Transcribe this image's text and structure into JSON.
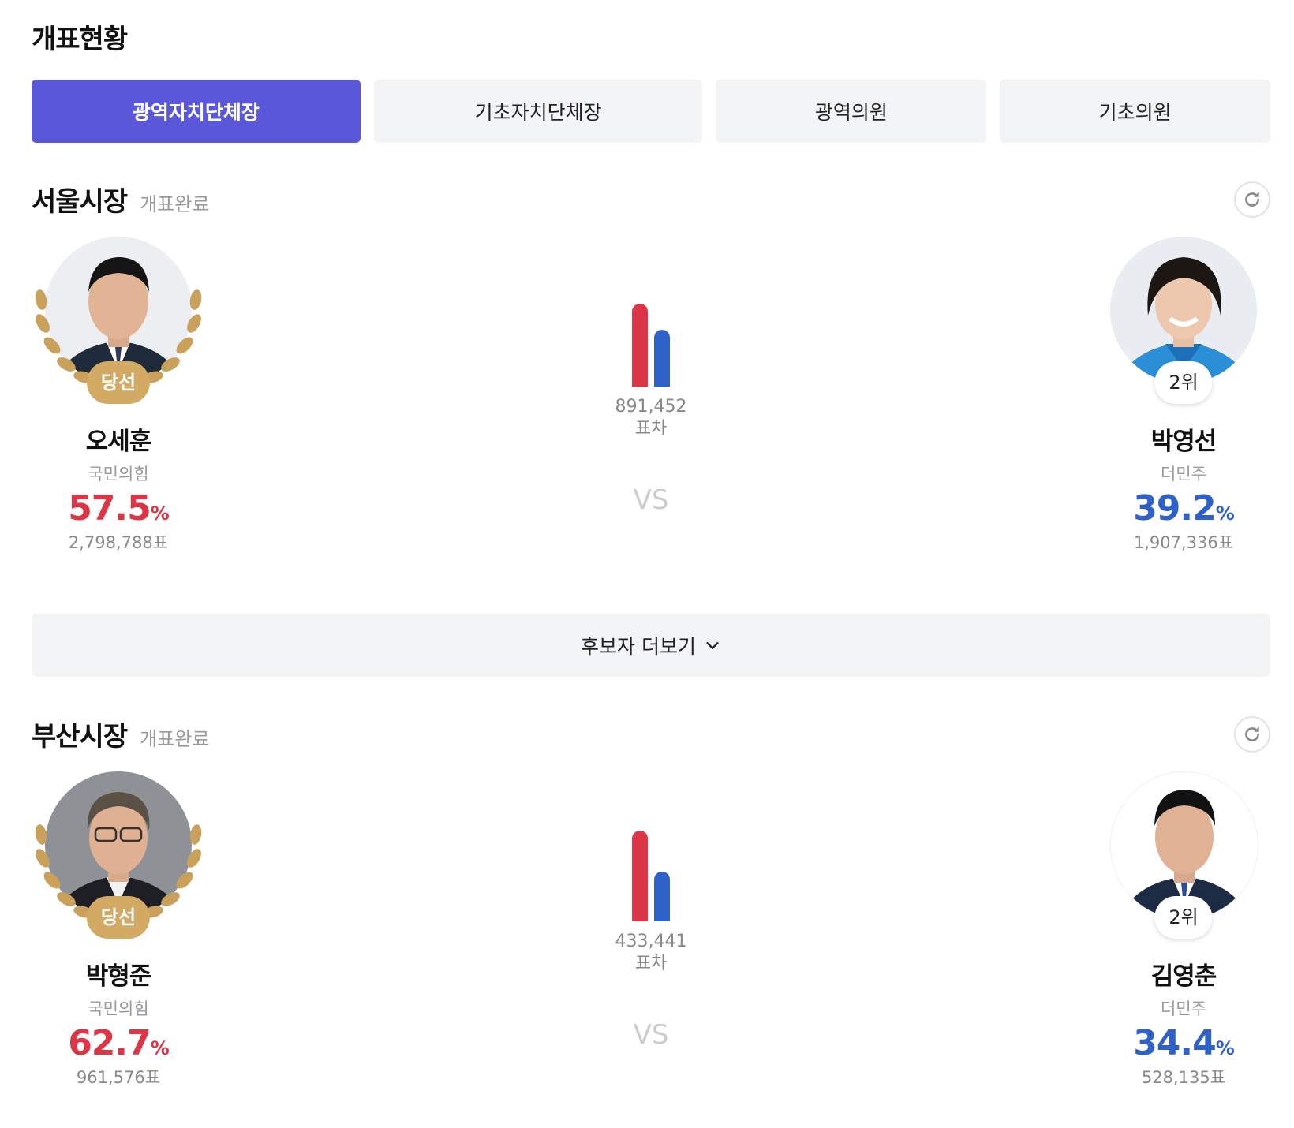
{
  "page_title": "개표현황",
  "tabs": [
    {
      "label": "광역자치단체장",
      "active": true
    },
    {
      "label": "기초자치단체장",
      "active": false
    },
    {
      "label": "광역의원",
      "active": false
    },
    {
      "label": "기초의원",
      "active": false
    }
  ],
  "races": [
    {
      "title": "서울시장",
      "status": "개표완료",
      "winner": {
        "badge": "당선",
        "name": "오세훈",
        "party": "국민의힘",
        "pct": "57.5",
        "pct_unit": "%",
        "votes": "2,798,788표"
      },
      "runner": {
        "badge": "2위",
        "name": "박영선",
        "party": "더민주",
        "pct": "39.2",
        "pct_unit": "%",
        "votes": "1,907,336표"
      },
      "diff_value": "891,452",
      "diff_label": "표차",
      "vs": "VS"
    },
    {
      "title": "부산시장",
      "status": "개표완료",
      "winner": {
        "badge": "당선",
        "name": "박형준",
        "party": "국민의힘",
        "pct": "62.7",
        "pct_unit": "%",
        "votes": "961,576표"
      },
      "runner": {
        "badge": "2위",
        "name": "김영춘",
        "party": "더민주",
        "pct": "34.4",
        "pct_unit": "%",
        "votes": "528,135표"
      },
      "diff_value": "433,441",
      "diff_label": "표차",
      "vs": "VS"
    }
  ],
  "more_button": {
    "label": "후보자 더보기",
    "icon": "chevron-down-icon"
  },
  "icons": {
    "refresh": "refresh-icon",
    "wreath": "laurel-wreath-icon"
  },
  "colors": {
    "accent": "#5a58d8",
    "winner_party": "#dc3545",
    "runner_party": "#2e62c9",
    "win_badge": "#d3aa63"
  }
}
